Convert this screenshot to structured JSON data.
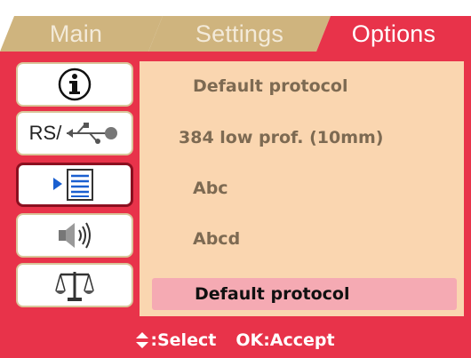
{
  "tabs": [
    {
      "label": "Main",
      "state": "inactive"
    },
    {
      "label": "Settings",
      "state": "inactive"
    },
    {
      "label": "Options",
      "state": "active"
    }
  ],
  "sidebar": {
    "items": [
      {
        "icon": "info-icon"
      },
      {
        "icon": "rs-connection-icon",
        "text": "RS/"
      },
      {
        "icon": "list-icon",
        "selected": true
      },
      {
        "icon": "speaker-icon"
      },
      {
        "icon": "balance-scale-icon"
      }
    ]
  },
  "options": {
    "items": [
      {
        "label": "Default protocol"
      },
      {
        "label": "384 low prof. (10mm)"
      },
      {
        "label": "Abc"
      },
      {
        "label": "Abcd"
      },
      {
        "label": "Default protocol",
        "highlighted": true
      }
    ]
  },
  "footer": {
    "select_label": ":Select",
    "accept_label": "OK:Accept"
  },
  "colors": {
    "accent": "#e8334a",
    "tab_inactive": "#cfb47e",
    "panel_bg": "#fad6b0",
    "highlight": "#f5aab3",
    "selected_border": "#8b1020"
  }
}
